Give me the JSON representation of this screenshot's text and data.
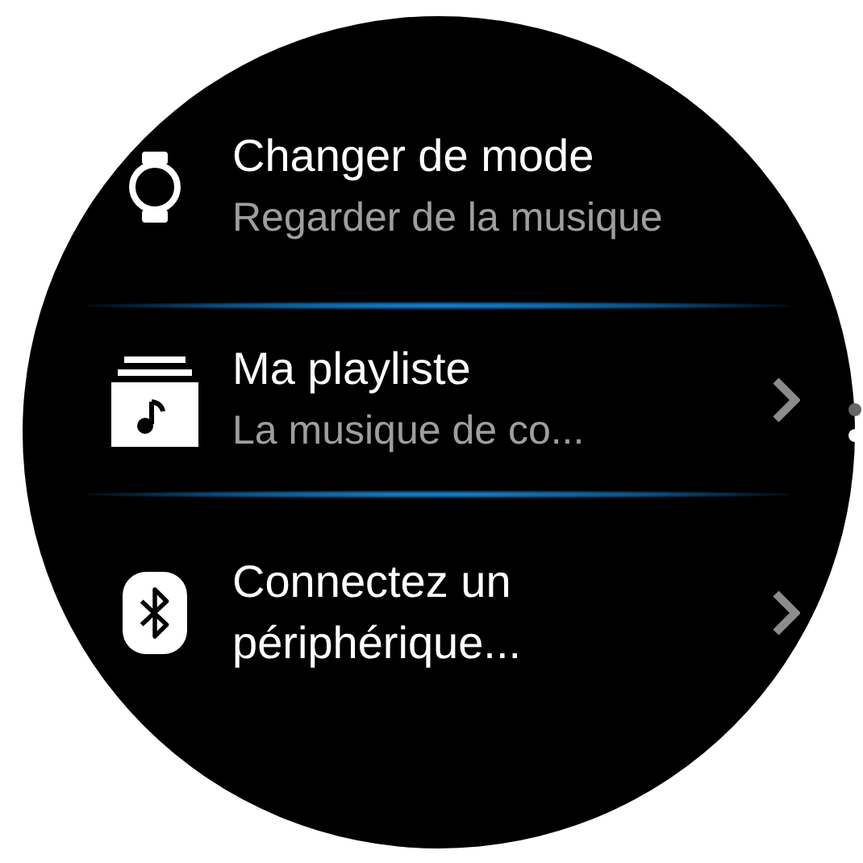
{
  "items": [
    {
      "title": "Changer de mode",
      "subtitle": "Regarder de la musique",
      "selected": false,
      "chevron": false
    },
    {
      "title": "Ma playliste",
      "subtitle": "La musique de co...",
      "selected": true,
      "chevron": true
    },
    {
      "title": "Connectez un périphérique...",
      "selected": false,
      "chevron": true
    }
  ],
  "page_indicator": [
    {
      "selected": false
    },
    {
      "selected": true
    }
  ]
}
